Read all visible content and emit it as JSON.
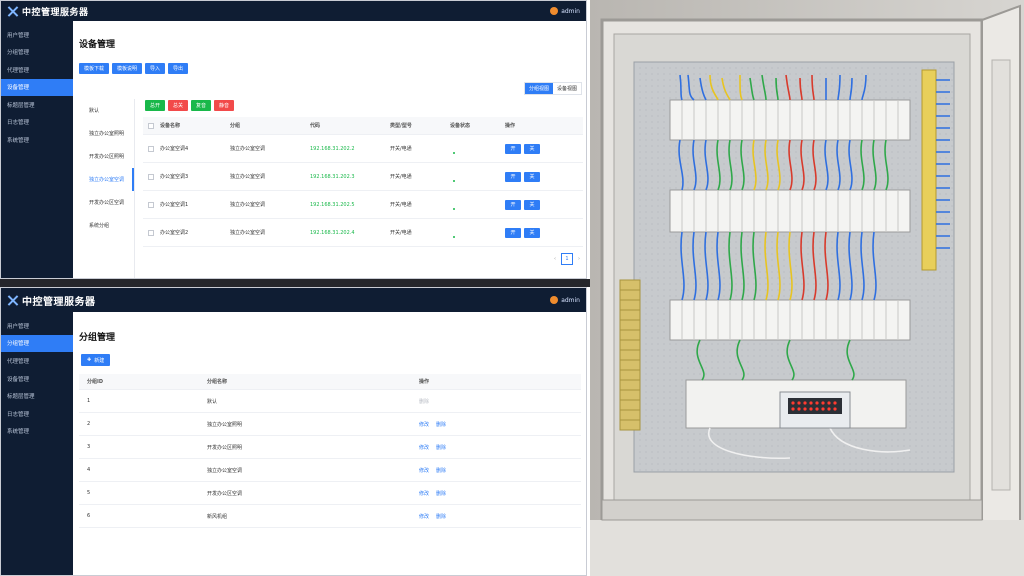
{
  "top_window": {
    "app_title": "中控管理服务器",
    "user_name": "admin",
    "sidebar": [
      "用户管理",
      "分组管理",
      "代理管理",
      "设备管理",
      "标题层管理",
      "日志管理",
      "系统管理"
    ],
    "active_sidebar_index": 3,
    "page_title": "设备管理",
    "buttons": [
      "模板下载",
      "模板说明",
      "导入",
      "导出"
    ],
    "view_tabs": [
      "分组视图",
      "设备视图"
    ],
    "groups": [
      "默认",
      "独立办公室照明",
      "开发办公区照明",
      "独立办公室空调",
      "开发办公区空调",
      "系统分组"
    ],
    "active_group_index": 3,
    "control_buttons": [
      "总开",
      "总关",
      "复音",
      "静音"
    ],
    "columns": [
      "设备名称",
      "分组",
      "代码",
      "类型/型号",
      "设备状态",
      "操作"
    ],
    "rows": [
      {
        "name": "办公室空调4",
        "group": "独立办公室空调",
        "code": "192.168.31.202.2",
        "type": "开关/电通",
        "op_on": "开",
        "op_off": "关"
      },
      {
        "name": "办公室空调3",
        "group": "独立办公室空调",
        "code": "192.168.31.202.3",
        "type": "开关/电通",
        "op_on": "开",
        "op_off": "关"
      },
      {
        "name": "办公室空调1",
        "group": "独立办公室空调",
        "code": "192.168.31.202.5",
        "type": "开关/电通",
        "op_on": "开",
        "op_off": "关"
      },
      {
        "name": "办公室空调2",
        "group": "独立办公室空调",
        "code": "192.168.31.202.4",
        "type": "开关/电通",
        "op_on": "开",
        "op_off": "关"
      }
    ],
    "pager": {
      "prev": "‹",
      "page": "1",
      "next": "›"
    }
  },
  "bottom_window": {
    "app_title": "中控管理服务器",
    "user_name": "admin",
    "sidebar": [
      "用户管理",
      "分组管理",
      "代理管理",
      "设备管理",
      "标题层管理",
      "日志管理",
      "系统管理"
    ],
    "active_sidebar_index": 1,
    "page_title": "分组管理",
    "new_button": "新建",
    "columns": [
      "分组ID",
      "分组名称",
      "操作"
    ],
    "rows": [
      {
        "id": "1",
        "name": "默认",
        "edit": "",
        "delete": "删除",
        "delete_disabled": true
      },
      {
        "id": "2",
        "name": "独立办公室照明",
        "edit": "修改",
        "delete": "删除",
        "delete_disabled": false
      },
      {
        "id": "3",
        "name": "开发办公区照明",
        "edit": "修改",
        "delete": "删除",
        "delete_disabled": false
      },
      {
        "id": "4",
        "name": "独立办公室空调",
        "edit": "修改",
        "delete": "删除",
        "delete_disabled": false
      },
      {
        "id": "5",
        "name": "开发办公区空调",
        "edit": "修改",
        "delete": "删除",
        "delete_disabled": false
      },
      {
        "id": "6",
        "name": "新风机组",
        "edit": "修改",
        "delete": "删除",
        "delete_disabled": false
      }
    ]
  },
  "colors": {
    "accent": "#2f7df6",
    "sidebar_bg": "#0f1d33",
    "success": "#19b84a",
    "danger": "#f24a4a"
  },
  "photo": {
    "icon": "electrical-panel-photo"
  }
}
